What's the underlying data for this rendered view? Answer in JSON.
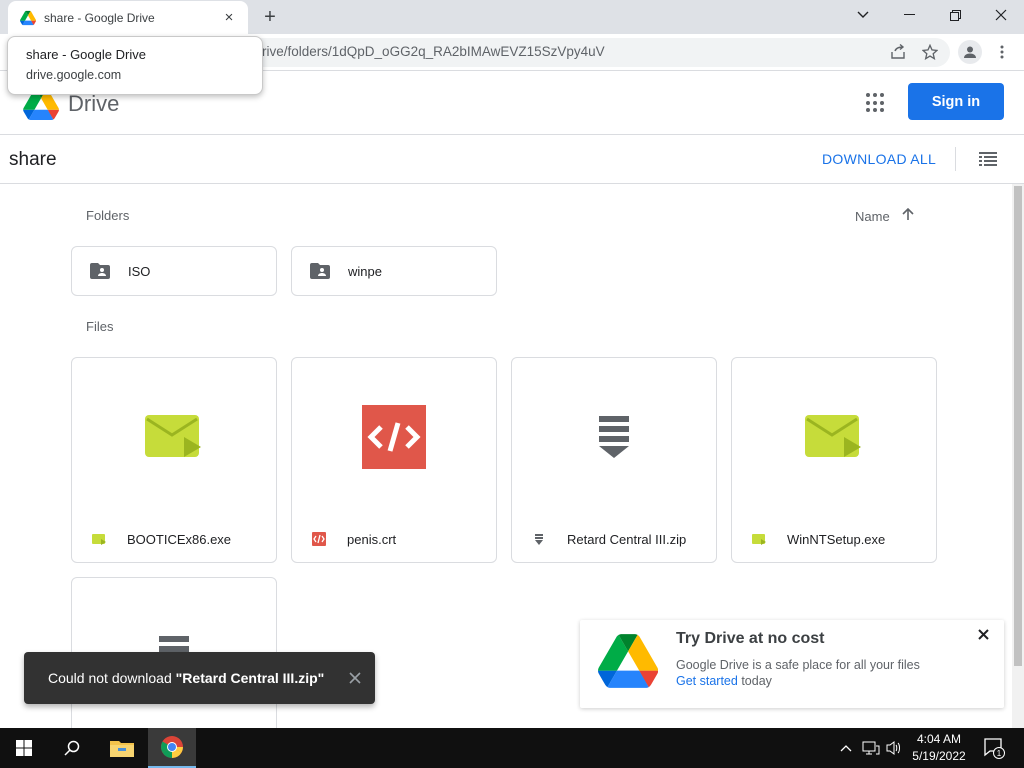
{
  "browser": {
    "tab_title": "share - Google Drive",
    "url_visible": "rive/folders/1dQpD_oGG2q_RA2bIMAwEVZ15SzVpy4uV",
    "new_tab_symbol": "+",
    "close_symbol": "×",
    "tooltip": {
      "title": "share - Google Drive",
      "url": "drive.google.com"
    }
  },
  "header": {
    "product": "Drive",
    "sign_in": "Sign in"
  },
  "folder_bar": {
    "title": "share",
    "download_all": "DOWNLOAD ALL"
  },
  "content": {
    "folders_label": "Folders",
    "files_label": "Files",
    "sort_label": "Name",
    "folders": [
      {
        "name": "ISO"
      },
      {
        "name": "winpe"
      }
    ],
    "files": [
      {
        "name": "BOOTICEx86.exe",
        "type": "exe"
      },
      {
        "name": "penis.crt",
        "type": "code"
      },
      {
        "name": "Retard Central III.zip",
        "type": "zip"
      },
      {
        "name": "WinNTSetup.exe",
        "type": "exe"
      },
      {
        "name": "",
        "type": "zip"
      }
    ]
  },
  "snackbar": {
    "prefix": "Could not download ",
    "filename": "\"Retard Central III.zip\""
  },
  "promo": {
    "title": "Try Drive at no cost",
    "description": "Google Drive is a safe place for all your files",
    "cta_link": "Get started",
    "cta_suffix": " today"
  },
  "taskbar": {
    "time": "4:04 AM",
    "date": "5/19/2022",
    "notification_count": "1"
  },
  "colors": {
    "accent": "#1a73e8",
    "exe_green": "#c6dc3a",
    "code_red": "#e0574a",
    "zip_gray": "#5f6368",
    "snackbar_bg": "#323232"
  }
}
